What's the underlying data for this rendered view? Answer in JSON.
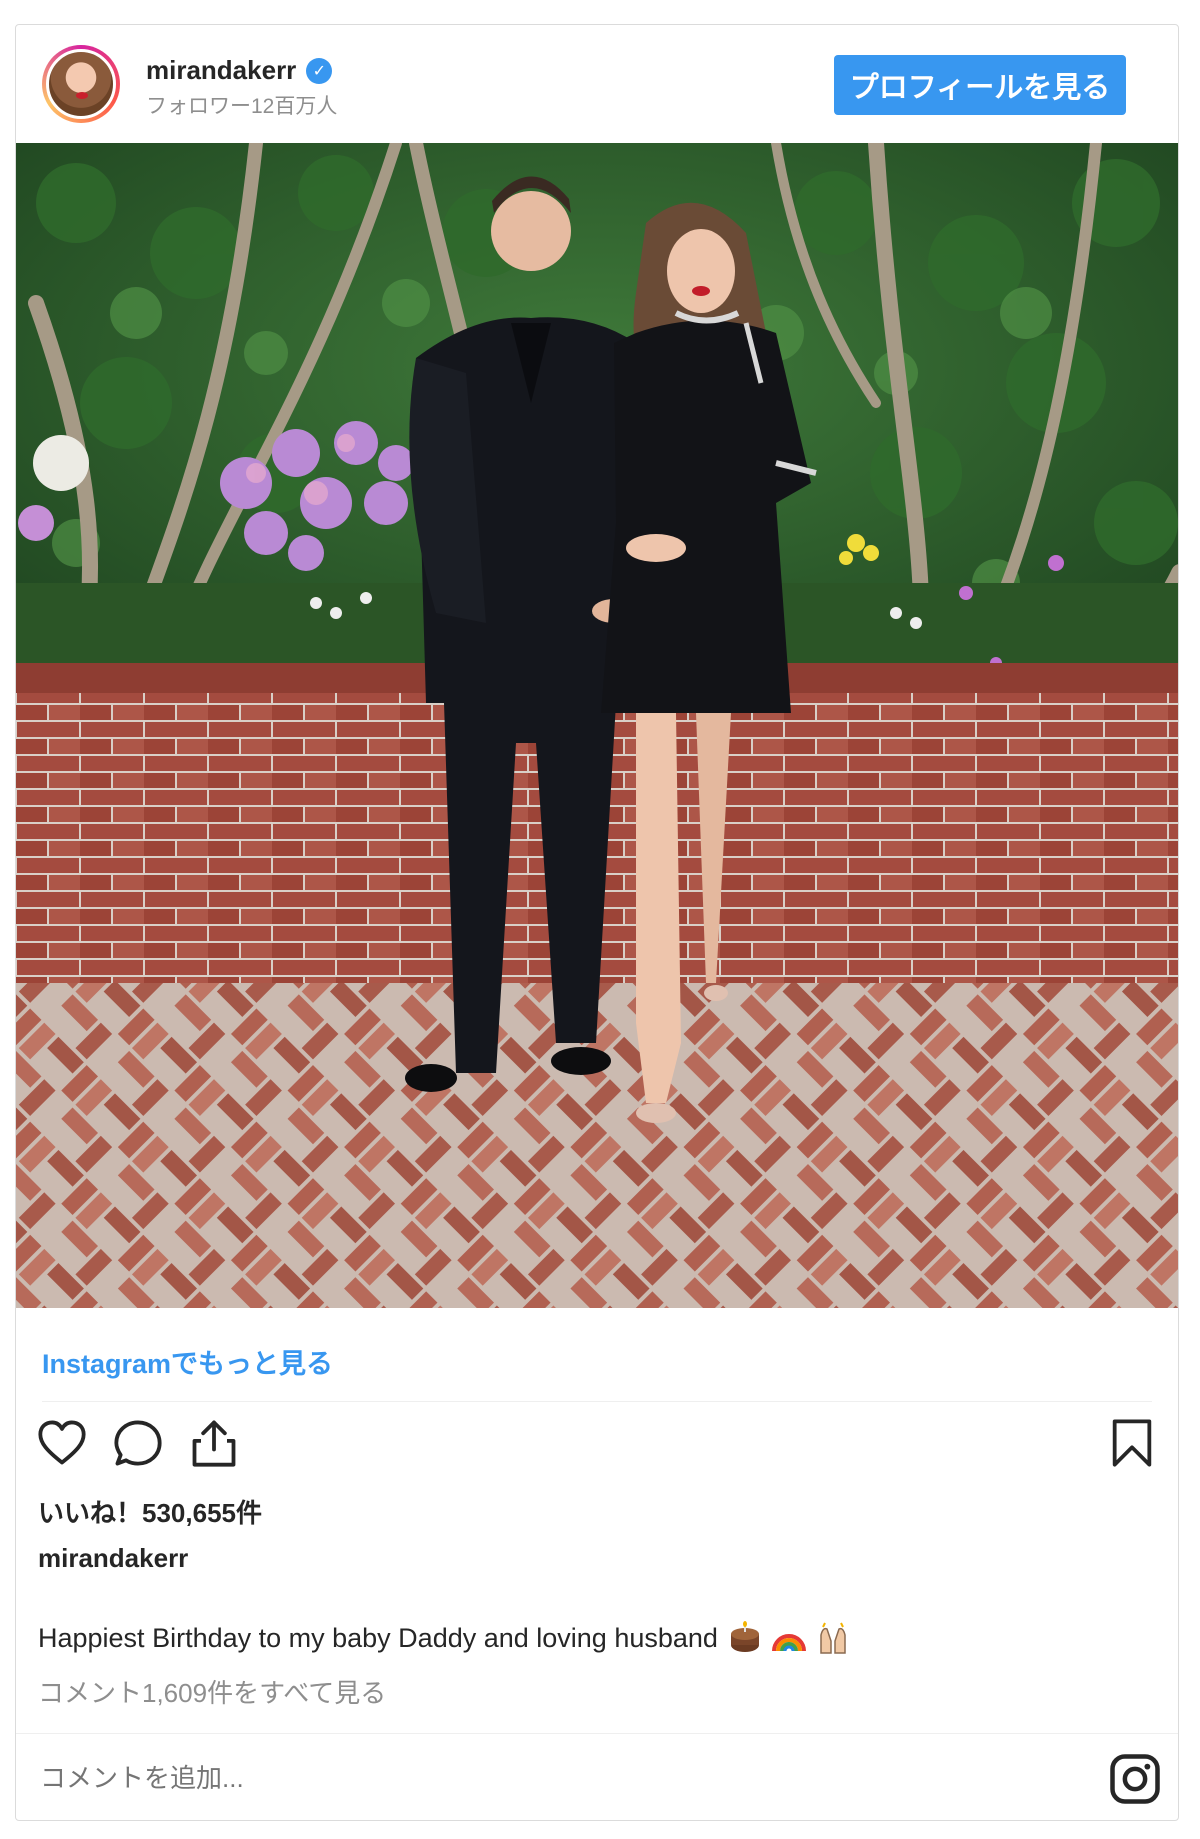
{
  "header": {
    "username": "mirandakerr",
    "verified_mark": "✓",
    "followers": "フォロワー12百万人",
    "profile_button": "プロフィールを見る"
  },
  "post": {
    "more_on_instagram": "Instagramでもっと見る",
    "likes": "いいね！530,655件",
    "author": "mirandakerr",
    "caption": "Happiest Birthday to my baby Daddy and loving husband",
    "view_comments": "コメント1,609件をすべて見る",
    "comment_placeholder": "コメントを追加..."
  },
  "icons": {
    "actions": [
      "heart-icon",
      "comment-icon",
      "share-icon",
      "bookmark-icon"
    ],
    "caption_emojis": [
      "cake-emoji",
      "rainbow-emoji",
      "raised-hands-emoji"
    ],
    "footer": "instagram-logo-icon"
  },
  "colors": {
    "accent": "#3897f0",
    "text": "#262626",
    "muted": "#8e8e8e",
    "border": "#dbdbdb"
  }
}
